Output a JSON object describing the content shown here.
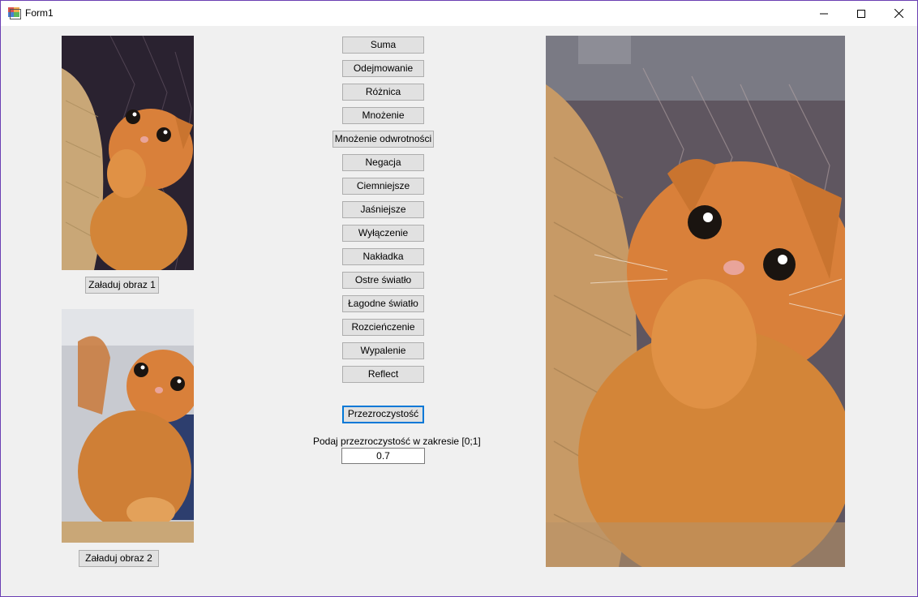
{
  "window": {
    "title": "Form1",
    "icon": "winforms-app-icon",
    "controls": {
      "minimize": "minimize-icon",
      "maximize": "maximize-icon",
      "close": "close-icon"
    },
    "border_color": "#6b3fb3"
  },
  "left_panel": {
    "load_image_1": "Załaduj obraz 1",
    "load_image_2": "Załaduj obraz 2"
  },
  "operations": [
    "Suma",
    "Odejmowanie",
    "Różnica",
    "Mnożenie",
    "Mnożenie odwrotności",
    "Negacja",
    "Ciemniejsze",
    "Jaśniejsze",
    "Wyłączenie",
    "Nakładka",
    "Ostre światło",
    "Łagodne światło",
    "Rozcieńczenie",
    "Wypalenie",
    "Reflect"
  ],
  "transparency": {
    "button_label": "Przezroczystość",
    "prompt": "Podaj przezroczystość w zakresie [0;1]",
    "value": "0.7"
  },
  "colors": {
    "form_background": "#f0f0f0",
    "button_face": "#e1e1e1",
    "button_border": "#adadad",
    "focus_border": "#0078d7",
    "cat_orange": "#d9803a"
  }
}
